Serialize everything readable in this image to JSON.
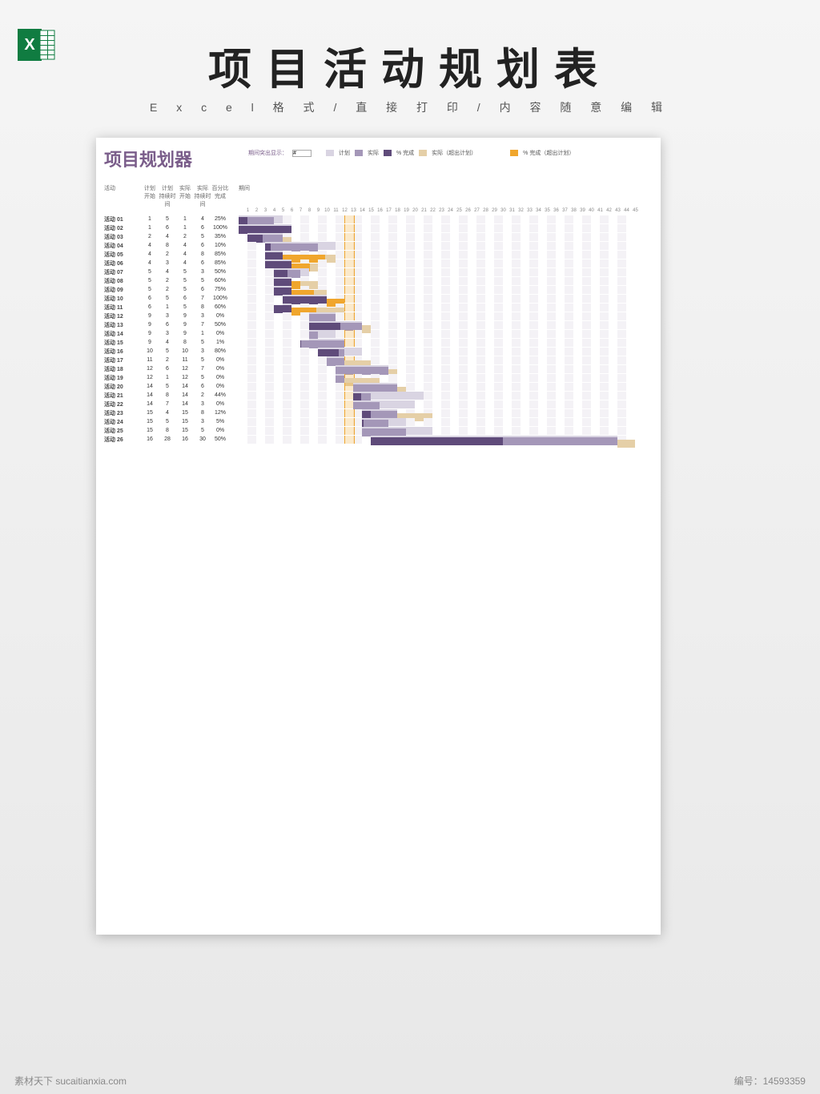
{
  "page": {
    "title": "项目活动规划表",
    "subtitle": "E x c e l 格 式 / 直 接 打 印 / 内 容 随 意 编 辑"
  },
  "footer": {
    "left": "素材天下 sucaitianxia.com",
    "right": "编号：14593359"
  },
  "sheet": {
    "title": "项目规划器",
    "highlight_label": "期间突出显示：",
    "highlight_value": "#",
    "highlight_period": 13,
    "legend": {
      "plan": "计划",
      "actual": "实际",
      "done": "% 完成",
      "over": "实际（超出计划）",
      "overdone": "% 完成（超出计划）"
    },
    "columns": {
      "activity": "活动",
      "plan_start": "计划 开始",
      "plan_dur": "计划 持续时间",
      "actual_start": "实际 开始",
      "actual_dur": "实际 持续时间",
      "pct": "百分比 完成",
      "periods": "期间"
    },
    "period_count": 45,
    "rows": [
      {
        "name": "活动 01",
        "ps": 1,
        "pd": 5,
        "as": 1,
        "ad": 4,
        "pct": "25%"
      },
      {
        "name": "活动 02",
        "ps": 1,
        "pd": 6,
        "as": 1,
        "ad": 6,
        "pct": "100%"
      },
      {
        "name": "活动 03",
        "ps": 2,
        "pd": 4,
        "as": 2,
        "ad": 5,
        "pct": "35%"
      },
      {
        "name": "活动 04",
        "ps": 4,
        "pd": 8,
        "as": 4,
        "ad": 6,
        "pct": "10%"
      },
      {
        "name": "活动 05",
        "ps": 4,
        "pd": 2,
        "as": 4,
        "ad": 8,
        "pct": "85%"
      },
      {
        "name": "活动 06",
        "ps": 4,
        "pd": 3,
        "as": 4,
        "ad": 6,
        "pct": "85%"
      },
      {
        "name": "活动 07",
        "ps": 5,
        "pd": 4,
        "as": 5,
        "ad": 3,
        "pct": "50%"
      },
      {
        "name": "活动 08",
        "ps": 5,
        "pd": 2,
        "as": 5,
        "ad": 5,
        "pct": "60%"
      },
      {
        "name": "活动 09",
        "ps": 5,
        "pd": 2,
        "as": 5,
        "ad": 6,
        "pct": "75%"
      },
      {
        "name": "活动 10",
        "ps": 6,
        "pd": 5,
        "as": 6,
        "ad": 7,
        "pct": "100%"
      },
      {
        "name": "活动 11",
        "ps": 6,
        "pd": 1,
        "as": 5,
        "ad": 8,
        "pct": "60%"
      },
      {
        "name": "活动 12",
        "ps": 9,
        "pd": 3,
        "as": 9,
        "ad": 3,
        "pct": "0%"
      },
      {
        "name": "活动 13",
        "ps": 9,
        "pd": 6,
        "as": 9,
        "ad": 7,
        "pct": "50%"
      },
      {
        "name": "活动 14",
        "ps": 9,
        "pd": 3,
        "as": 9,
        "ad": 1,
        "pct": "0%"
      },
      {
        "name": "活动 15",
        "ps": 9,
        "pd": 4,
        "as": 8,
        "ad": 5,
        "pct": "1%"
      },
      {
        "name": "活动 16",
        "ps": 10,
        "pd": 5,
        "as": 10,
        "ad": 3,
        "pct": "80%"
      },
      {
        "name": "活动 17",
        "ps": 11,
        "pd": 2,
        "as": 11,
        "ad": 5,
        "pct": "0%"
      },
      {
        "name": "活动 18",
        "ps": 12,
        "pd": 6,
        "as": 12,
        "ad": 7,
        "pct": "0%"
      },
      {
        "name": "活动 19",
        "ps": 12,
        "pd": 1,
        "as": 12,
        "ad": 5,
        "pct": "0%"
      },
      {
        "name": "活动 20",
        "ps": 14,
        "pd": 5,
        "as": 14,
        "ad": 6,
        "pct": "0%"
      },
      {
        "name": "活动 21",
        "ps": 14,
        "pd": 8,
        "as": 14,
        "ad": 2,
        "pct": "44%"
      },
      {
        "name": "活动 22",
        "ps": 14,
        "pd": 7,
        "as": 14,
        "ad": 3,
        "pct": "0%"
      },
      {
        "name": "活动 23",
        "ps": 15,
        "pd": 4,
        "as": 15,
        "ad": 8,
        "pct": "12%"
      },
      {
        "name": "活动 24",
        "ps": 15,
        "pd": 5,
        "as": 15,
        "ad": 3,
        "pct": "5%"
      },
      {
        "name": "活动 25",
        "ps": 15,
        "pd": 8,
        "as": 15,
        "ad": 5,
        "pct": "0%"
      },
      {
        "name": "活动 26",
        "ps": 16,
        "pd": 28,
        "as": 16,
        "ad": 30,
        "pct": "50%"
      }
    ]
  },
  "chart_data": {
    "type": "bar",
    "title": "项目规划器",
    "xlabel": "期间",
    "ylabel": "活动",
    "x": [
      1,
      2,
      3,
      4,
      5,
      6,
      7,
      8,
      9,
      10,
      11,
      12,
      13,
      14,
      15,
      16,
      17,
      18,
      19,
      20,
      21,
      22,
      23,
      24,
      25,
      26,
      27,
      28,
      29,
      30,
      31,
      32,
      33,
      34,
      35,
      36,
      37,
      38,
      39,
      40,
      41,
      42,
      43,
      44,
      45
    ],
    "categories": [
      "活动 01",
      "活动 02",
      "活动 03",
      "活动 04",
      "活动 05",
      "活动 06",
      "活动 07",
      "活动 08",
      "活动 09",
      "活动 10",
      "活动 11",
      "活动 12",
      "活动 13",
      "活动 14",
      "活动 15",
      "活动 16",
      "活动 17",
      "活动 18",
      "活动 19",
      "活动 20",
      "活动 21",
      "活动 22",
      "活动 23",
      "活动 24",
      "活动 25",
      "活动 26"
    ],
    "series": [
      {
        "name": "计划 开始",
        "values": [
          1,
          1,
          2,
          4,
          4,
          4,
          5,
          5,
          5,
          6,
          6,
          9,
          9,
          9,
          9,
          10,
          11,
          12,
          12,
          14,
          14,
          14,
          15,
          15,
          15,
          16
        ]
      },
      {
        "name": "计划 持续时间",
        "values": [
          5,
          6,
          4,
          8,
          2,
          3,
          4,
          2,
          2,
          5,
          1,
          3,
          6,
          3,
          4,
          5,
          2,
          6,
          1,
          5,
          8,
          7,
          4,
          5,
          8,
          28
        ]
      },
      {
        "name": "实际 开始",
        "values": [
          1,
          1,
          2,
          4,
          4,
          4,
          5,
          5,
          5,
          6,
          5,
          9,
          9,
          9,
          8,
          10,
          11,
          12,
          12,
          14,
          14,
          14,
          15,
          15,
          15,
          16
        ]
      },
      {
        "name": "实际 持续时间",
        "values": [
          4,
          6,
          5,
          6,
          8,
          6,
          3,
          5,
          6,
          7,
          8,
          3,
          7,
          1,
          5,
          3,
          5,
          7,
          5,
          6,
          2,
          3,
          8,
          3,
          5,
          30
        ]
      },
      {
        "name": "% 完成",
        "values": [
          25,
          100,
          35,
          10,
          85,
          85,
          50,
          60,
          75,
          100,
          60,
          0,
          50,
          0,
          1,
          80,
          0,
          0,
          0,
          0,
          44,
          0,
          12,
          5,
          0,
          50
        ]
      }
    ],
    "xlim": [
      1,
      45
    ]
  }
}
